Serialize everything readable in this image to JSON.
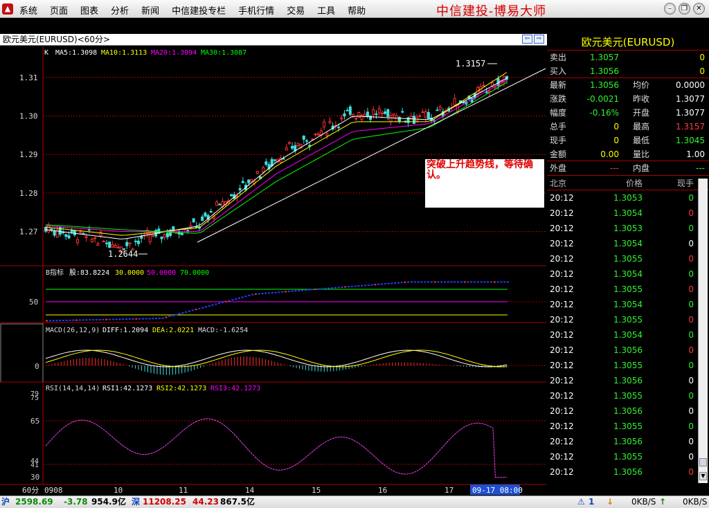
{
  "menubar": {
    "items": [
      "系统",
      "页面",
      "图表",
      "分析",
      "新闻",
      "中信建投专栏",
      "手机行情",
      "交易",
      "工具",
      "帮助"
    ],
    "brand": "中信建投-博易大师"
  },
  "chart": {
    "title": "欧元美元(EURUSD)<60分>",
    "ma_line": {
      "k": "K",
      "ma5": "MA5:1.3098",
      "ma10": "MA10:1.3113",
      "ma20": "MA20:1.3094",
      "ma30": "MA30:1.3087"
    },
    "price_ticks": [
      "1.31",
      "1.30",
      "1.29",
      "1.28",
      "1.27"
    ],
    "high_label": "1.3157",
    "low_label": "1.2644",
    "annotation": "突破上升趋势线，等待确认。",
    "b_indicator": {
      "label": "B指标",
      "gu": "股:83.8224",
      "v30": "30.0000",
      "v50": "50.0000",
      "v70": "70.0000",
      "tick": "50"
    },
    "macd": {
      "label": "MACD(26,12,9)",
      "diff": "DIFF:1.2094",
      "dea": "DEA:2.0221",
      "macd": "MACD:-1.6254",
      "tick": "0"
    },
    "rsi": {
      "label": "RSI(14,14,14)",
      "rsi1": "RSI1:42.1273",
      "rsi2": "RSI2:42.1273",
      "rsi3": "RSI3:42.1273",
      "ticks": [
        "79",
        "75",
        "65",
        "44",
        "41",
        "30"
      ]
    },
    "period": "60分",
    "dates": [
      "0908",
      "10",
      "11",
      "14",
      "15",
      "16",
      "17"
    ],
    "cursor_date": "09-17 08:00"
  },
  "chart_data": {
    "type": "line",
    "title": "欧元美元(EURUSD)<60分>",
    "xlabel": "",
    "ylabel": "",
    "ylim": [
      1.2615,
      1.3175
    ],
    "x": [
      "0908",
      "10",
      "11",
      "14",
      "15",
      "16",
      "17"
    ],
    "series": [
      {
        "name": "K",
        "values": [
          1.271,
          1.2665,
          1.272,
          1.289,
          1.301,
          1.2995,
          1.3095
        ]
      },
      {
        "name": "MA5",
        "values": [
          1.2705,
          1.268,
          1.2715,
          1.288,
          1.3,
          1.299,
          1.3098
        ]
      },
      {
        "name": "MA10",
        "values": [
          1.2712,
          1.269,
          1.271,
          1.287,
          1.2985,
          1.2985,
          1.3113
        ]
      },
      {
        "name": "MA20",
        "values": [
          1.2715,
          1.27,
          1.27,
          1.285,
          1.296,
          1.298,
          1.3094
        ]
      },
      {
        "name": "MA30",
        "values": [
          1.2718,
          1.2705,
          1.2695,
          1.283,
          1.294,
          1.297,
          1.3087
        ]
      }
    ],
    "annotations": [
      "1.3157",
      "1.2644",
      "突破上升趋势线，等待确认。"
    ]
  },
  "quote": {
    "title": "欧元美元(EURUSD)",
    "rows": [
      {
        "l": "卖出",
        "v": "1.3057",
        "vc": "green",
        "l2": "",
        "v2": "0",
        "v2c": "yel"
      },
      {
        "l": "买入",
        "v": "1.3056",
        "vc": "green",
        "l2": "",
        "v2": "0",
        "v2c": "yel"
      },
      {
        "l": "最新",
        "v": "1.3056",
        "vc": "green",
        "l2": "均价",
        "v2": "0.0000",
        "v2c": "white"
      },
      {
        "l": "涨跌",
        "v": "-0.0021",
        "vc": "green",
        "l2": "昨收",
        "v2": "1.3077",
        "v2c": "white"
      },
      {
        "l": "幅度",
        "v": "-0.16%",
        "vc": "green",
        "l2": "开盘",
        "v2": "1.3077",
        "v2c": "white"
      },
      {
        "l": "总手",
        "v": "0",
        "vc": "yel",
        "l2": "最高",
        "v2": "1.3157",
        "v2c": "red"
      },
      {
        "l": "现手",
        "v": "0",
        "vc": "yel",
        "l2": "最低",
        "v2": "1.3045",
        "v2c": "green"
      },
      {
        "l": "金额",
        "v": "0.00",
        "vc": "yel",
        "l2": "量比",
        "v2": "1.00",
        "v2c": "white"
      },
      {
        "l": "外盘",
        "v": "---",
        "vc": "red",
        "l2": "内盘",
        "v2": "---",
        "v2c": "green"
      }
    ],
    "tick_headers": [
      "北京",
      "价格",
      "现手"
    ],
    "ticks": [
      {
        "t": "20:12",
        "p": "1.3053",
        "q": "0",
        "qc": "green"
      },
      {
        "t": "20:12",
        "p": "1.3054",
        "q": "0",
        "qc": "red"
      },
      {
        "t": "20:12",
        "p": "1.3053",
        "q": "0",
        "qc": "green"
      },
      {
        "t": "20:12",
        "p": "1.3054",
        "q": "0",
        "qc": "white"
      },
      {
        "t": "20:12",
        "p": "1.3055",
        "q": "0",
        "qc": "red"
      },
      {
        "t": "20:12",
        "p": "1.3054",
        "q": "0",
        "qc": "green"
      },
      {
        "t": "20:12",
        "p": "1.3055",
        "q": "0",
        "qc": "red"
      },
      {
        "t": "20:12",
        "p": "1.3054",
        "q": "0",
        "qc": "green"
      },
      {
        "t": "20:12",
        "p": "1.3055",
        "q": "0",
        "qc": "red"
      },
      {
        "t": "20:12",
        "p": "1.3054",
        "q": "0",
        "qc": "green"
      },
      {
        "t": "20:12",
        "p": "1.3056",
        "q": "0",
        "qc": "red"
      },
      {
        "t": "20:12",
        "p": "1.3055",
        "q": "0",
        "qc": "green"
      },
      {
        "t": "20:12",
        "p": "1.3056",
        "q": "0",
        "qc": "white"
      },
      {
        "t": "20:12",
        "p": "1.3055",
        "q": "0",
        "qc": "green"
      },
      {
        "t": "20:12",
        "p": "1.3056",
        "q": "0",
        "qc": "white"
      },
      {
        "t": "20:12",
        "p": "1.3055",
        "q": "0",
        "qc": "green"
      },
      {
        "t": "20:12",
        "p": "1.3056",
        "q": "0",
        "qc": "white"
      },
      {
        "t": "20:12",
        "p": "1.3055",
        "q": "0",
        "qc": "white"
      },
      {
        "t": "20:12",
        "p": "1.3056",
        "q": "0",
        "qc": "red"
      }
    ]
  },
  "status": {
    "sh_label": "沪",
    "sh_index": "2598.69",
    "sh_change": "-3.78",
    "sh_amount": "954.9亿",
    "sz_label": "深",
    "sz_index": "11208.25",
    "sz_change": "44.23",
    "sz_amount": "867.5亿",
    "alert": "1",
    "speed1": "0KB/S",
    "speed2": "0KB/S"
  }
}
